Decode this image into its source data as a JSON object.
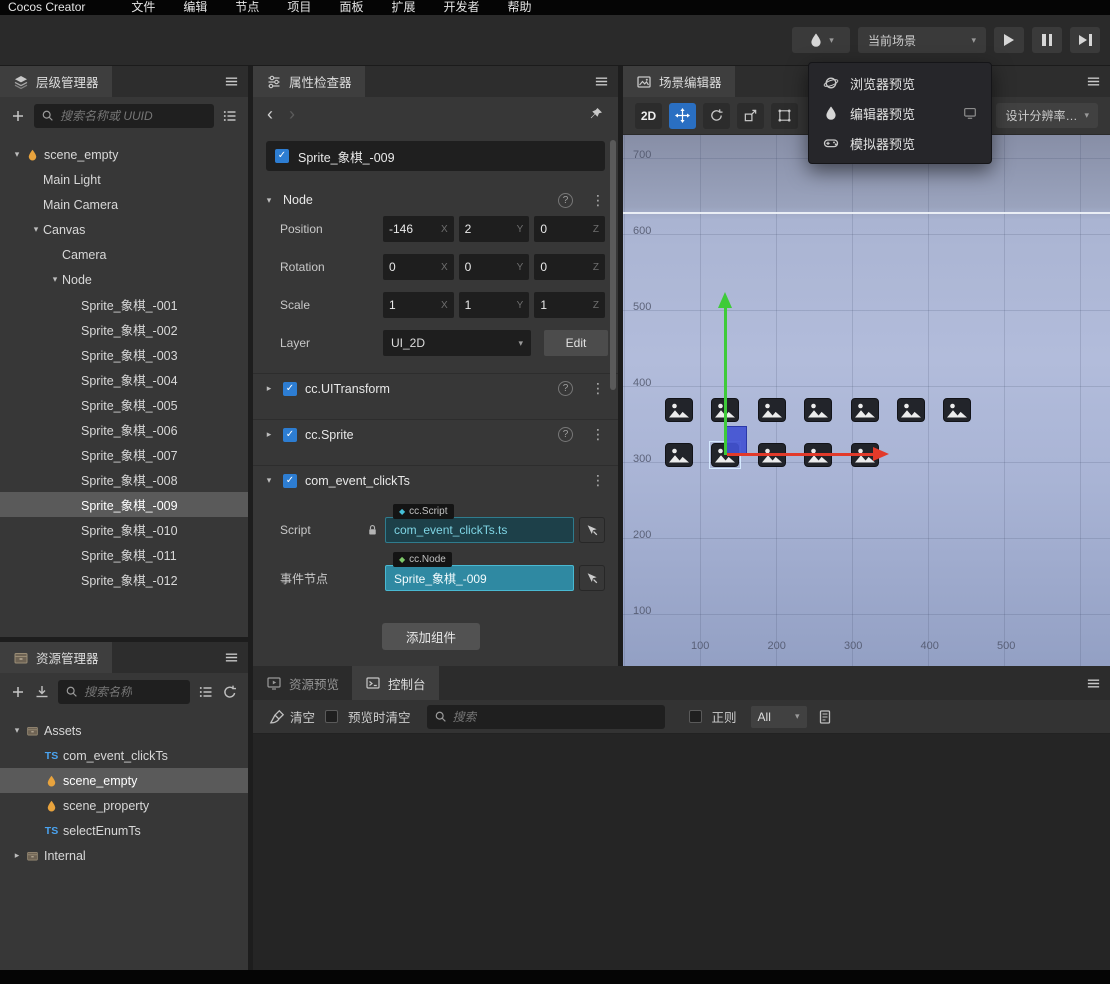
{
  "menubar": {
    "brand": "Cocos Creator",
    "items": [
      {
        "label": "文件",
        "name": "file"
      },
      {
        "label": "编辑",
        "name": "edit"
      },
      {
        "label": "节点",
        "name": "node"
      },
      {
        "label": "项目",
        "name": "project"
      },
      {
        "label": "面板",
        "name": "panel"
      },
      {
        "label": "扩展",
        "name": "extension"
      },
      {
        "label": "开发者",
        "name": "developer"
      },
      {
        "label": "帮助",
        "name": "help"
      }
    ]
  },
  "toolbar": {
    "scene_select": "当前场景",
    "preview_menu": [
      {
        "label": "浏览器预览",
        "name": "browser-preview",
        "icon": "browser"
      },
      {
        "label": "编辑器预览",
        "name": "editor-preview",
        "icon": "drop",
        "trailing_icon": "window"
      },
      {
        "label": "模拟器预览",
        "name": "simulator-preview",
        "icon": "gamepad"
      }
    ]
  },
  "hierarchy": {
    "title": "层级管理器",
    "search_placeholder": "搜索名称或 UUID",
    "tree": [
      {
        "label": "scene_empty",
        "depth": 0,
        "arrow": "open",
        "icon": "scene"
      },
      {
        "label": "Main Light",
        "depth": 1
      },
      {
        "label": "Main Camera",
        "depth": 1
      },
      {
        "label": "Canvas",
        "depth": 1,
        "arrow": "open"
      },
      {
        "label": "Camera",
        "depth": 2
      },
      {
        "label": "Node",
        "depth": 2,
        "arrow": "open"
      },
      {
        "label": "Sprite_象棋_-001",
        "depth": 3
      },
      {
        "label": "Sprite_象棋_-002",
        "depth": 3
      },
      {
        "label": "Sprite_象棋_-003",
        "depth": 3
      },
      {
        "label": "Sprite_象棋_-004",
        "depth": 3
      },
      {
        "label": "Sprite_象棋_-005",
        "depth": 3
      },
      {
        "label": "Sprite_象棋_-006",
        "depth": 3
      },
      {
        "label": "Sprite_象棋_-007",
        "depth": 3
      },
      {
        "label": "Sprite_象棋_-008",
        "depth": 3
      },
      {
        "label": "Sprite_象棋_-009",
        "depth": 3,
        "selected": true
      },
      {
        "label": "Sprite_象棋_-010",
        "depth": 3
      },
      {
        "label": "Sprite_象棋_-011",
        "depth": 3
      },
      {
        "label": "Sprite_象棋_-012",
        "depth": 3
      }
    ]
  },
  "assets": {
    "title": "资源管理器",
    "search_placeholder": "搜索名称",
    "tree": [
      {
        "label": "Assets",
        "depth": 0,
        "arrow": "open",
        "icon": "assets"
      },
      {
        "label": "com_event_clickTs",
        "depth": 1,
        "icon": "ts"
      },
      {
        "label": "scene_empty",
        "depth": 1,
        "icon": "scene",
        "selected": true
      },
      {
        "label": "scene_property",
        "depth": 1,
        "icon": "scene"
      },
      {
        "label": "selectEnumTs",
        "depth": 1,
        "icon": "ts"
      },
      {
        "label": "Internal",
        "depth": 0,
        "arrow": "closed",
        "icon": "assets"
      }
    ]
  },
  "inspector": {
    "title": "属性检查器",
    "node_name": "Sprite_象棋_-009",
    "node_section": "Node",
    "labels": {
      "position": "Position",
      "rotation": "Rotation",
      "scale": "Scale",
      "layer": "Layer",
      "script": "Script",
      "event_node": "事件节点"
    },
    "axis": {
      "x": "X",
      "y": "Y",
      "z": "Z"
    },
    "position": {
      "x": "-146",
      "y": "2",
      "z": "0"
    },
    "rotation": {
      "x": "0",
      "y": "0",
      "z": "0"
    },
    "scale": {
      "x": "1",
      "y": "1",
      "z": "1"
    },
    "layer_value": "UI_2D",
    "edit_label": "Edit",
    "components": {
      "uitransform": "cc.UITransform",
      "sprite": "cc.Sprite",
      "event": "com_event_clickTs"
    },
    "script_chip": "cc.Script",
    "script_value": "com_event_clickTs.ts",
    "node_chip": "cc.Node",
    "event_node_value": "Sprite_象棋_-009",
    "add_component": "添加组件"
  },
  "scene": {
    "title": "场景编辑器",
    "mode_2d": "2D",
    "resolution_label": "设计分辨率…",
    "ruler_y": [
      "700",
      "600",
      "500",
      "400",
      "300",
      "200",
      "100"
    ],
    "ruler_x": [
      "100",
      "200",
      "300",
      "400",
      "500"
    ],
    "sprites_row1": 7,
    "sprites_row2": 5
  },
  "console": {
    "tab_preview": "资源预览",
    "tab_console": "控制台",
    "clear_label": "清空",
    "clear_on_preview_label": "预览时清空",
    "search_placeholder": "搜索",
    "regex_label": "正则",
    "filter_value": "All"
  },
  "colors": {
    "accent_blue": "#2d7dd2",
    "tool_active_blue": "#2a6fc2",
    "ref_teal": "#2f89a2",
    "scene_icon_orange": "#e8a33d",
    "gizmo_green": "#3ecb39",
    "gizmo_red": "#e23a2a",
    "gizmo_blue": "#4252d2",
    "ts_badge_blue": "#4aa3f0"
  }
}
